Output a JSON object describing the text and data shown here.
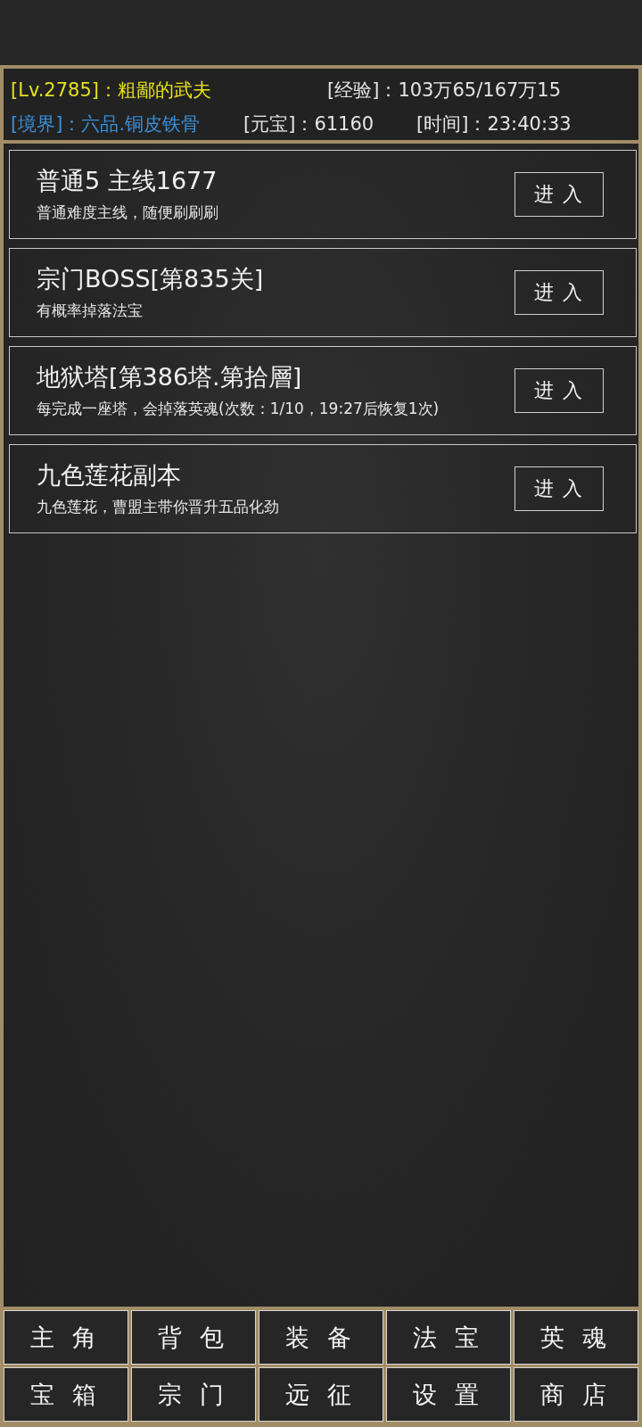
{
  "header": {
    "rows": [
      {
        "fields": [
          {
            "text": "[Lv.2785]：粗鄙的武夫",
            "color": "#e6e01e"
          },
          {
            "text": "[经验]：103万65/167万15",
            "color": "#e4e4e4"
          }
        ]
      },
      {
        "fields": [
          {
            "text": "[境界]：六品.铜皮铁骨",
            "color": "#3a8fd8"
          },
          {
            "text": "[元宝]：61160",
            "color": "#e4e4e4"
          },
          {
            "text": "[时间]：23:40:33",
            "color": "#e4e4e4"
          }
        ]
      }
    ]
  },
  "stages": [
    {
      "title": "普通5 主线1677",
      "description": "普通难度主线，随便刷刷刷",
      "button": "进 入"
    },
    {
      "title": "宗门BOSS[第835关]",
      "description": "有概率掉落法宝",
      "button": "进 入"
    },
    {
      "title": "地狱塔[第386塔.第拾層]",
      "description": "每完成一座塔，会掉落英魂(次数：1/10，19:27后恢复1次)",
      "button": "进 入"
    },
    {
      "title": "九色莲花副本",
      "description": "九色莲花，曹盟主带你晋升五品化劲",
      "button": "进 入"
    }
  ],
  "nav": {
    "rows": [
      {
        "items": [
          "主 角",
          "背 包",
          "装 备",
          "法 宝",
          "英 魂"
        ]
      },
      {
        "items": [
          "宝 箱",
          "宗 门",
          "远 征",
          "设 置",
          "商 店"
        ]
      }
    ]
  }
}
